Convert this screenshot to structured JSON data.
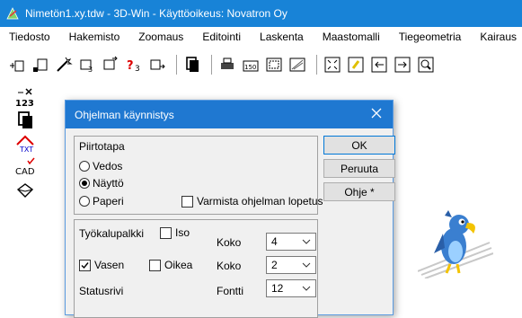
{
  "window": {
    "title": "Nimetön1.xy.tdw - 3D-Win - Käyttöoikeus: Novatron Oy"
  },
  "menu": [
    "Tiedosto",
    "Hakemisto",
    "Zoomaus",
    "Editointi",
    "Laskenta",
    "Maastomalli",
    "Tiegeometria",
    "Kairaus"
  ],
  "dialog": {
    "title": "Ohjelman käynnistys",
    "piirtotapa": {
      "label": "Piirtotapa",
      "options": [
        "Vedos",
        "Näyttö",
        "Paperi"
      ],
      "selected": "Näyttö"
    },
    "confirm_exit_label": "Varmista ohjelman lopetus",
    "confirm_exit_checked": false,
    "buttons": {
      "ok": "OK",
      "cancel": "Peruuta",
      "help": "Ohje *"
    },
    "toolbar_section": {
      "label": "Työkalupalkki",
      "iso_label": "Iso",
      "iso_checked": false,
      "koko_label": "Koko",
      "koko_value": "4",
      "vasen_label": "Vasen",
      "vasen_checked": true,
      "oikea_label": "Oikea",
      "oikea_checked": false,
      "koko2_label": "Koko",
      "koko2_value": "2"
    },
    "status_section": {
      "label": "Statusrivi",
      "fontti_label": "Fontti",
      "fontti_value": "12"
    }
  },
  "colors": {
    "titlebar": "#1883d7",
    "dialog_titlebar": "#1f78d1",
    "dialog_bg": "#f0f0f0"
  },
  "icons": {
    "toolbar": [
      "new-point-icon",
      "new-file-icon",
      "wand-icon",
      "points-icon",
      "points-export-icon",
      "query-points-icon",
      "points-arrow-icon",
      "copy-icon",
      "print-icon",
      "scale-icon",
      "frame-icon",
      "map-icon",
      "zoom-extent-icon",
      "zoom-window-icon",
      "pan-left-icon",
      "pan-right-icon",
      "zoom-in-icon"
    ],
    "left": [
      "number-edit-icon",
      "layers-icon",
      "text-roof-icon",
      "cad-check-icon",
      "shape-icon"
    ]
  }
}
